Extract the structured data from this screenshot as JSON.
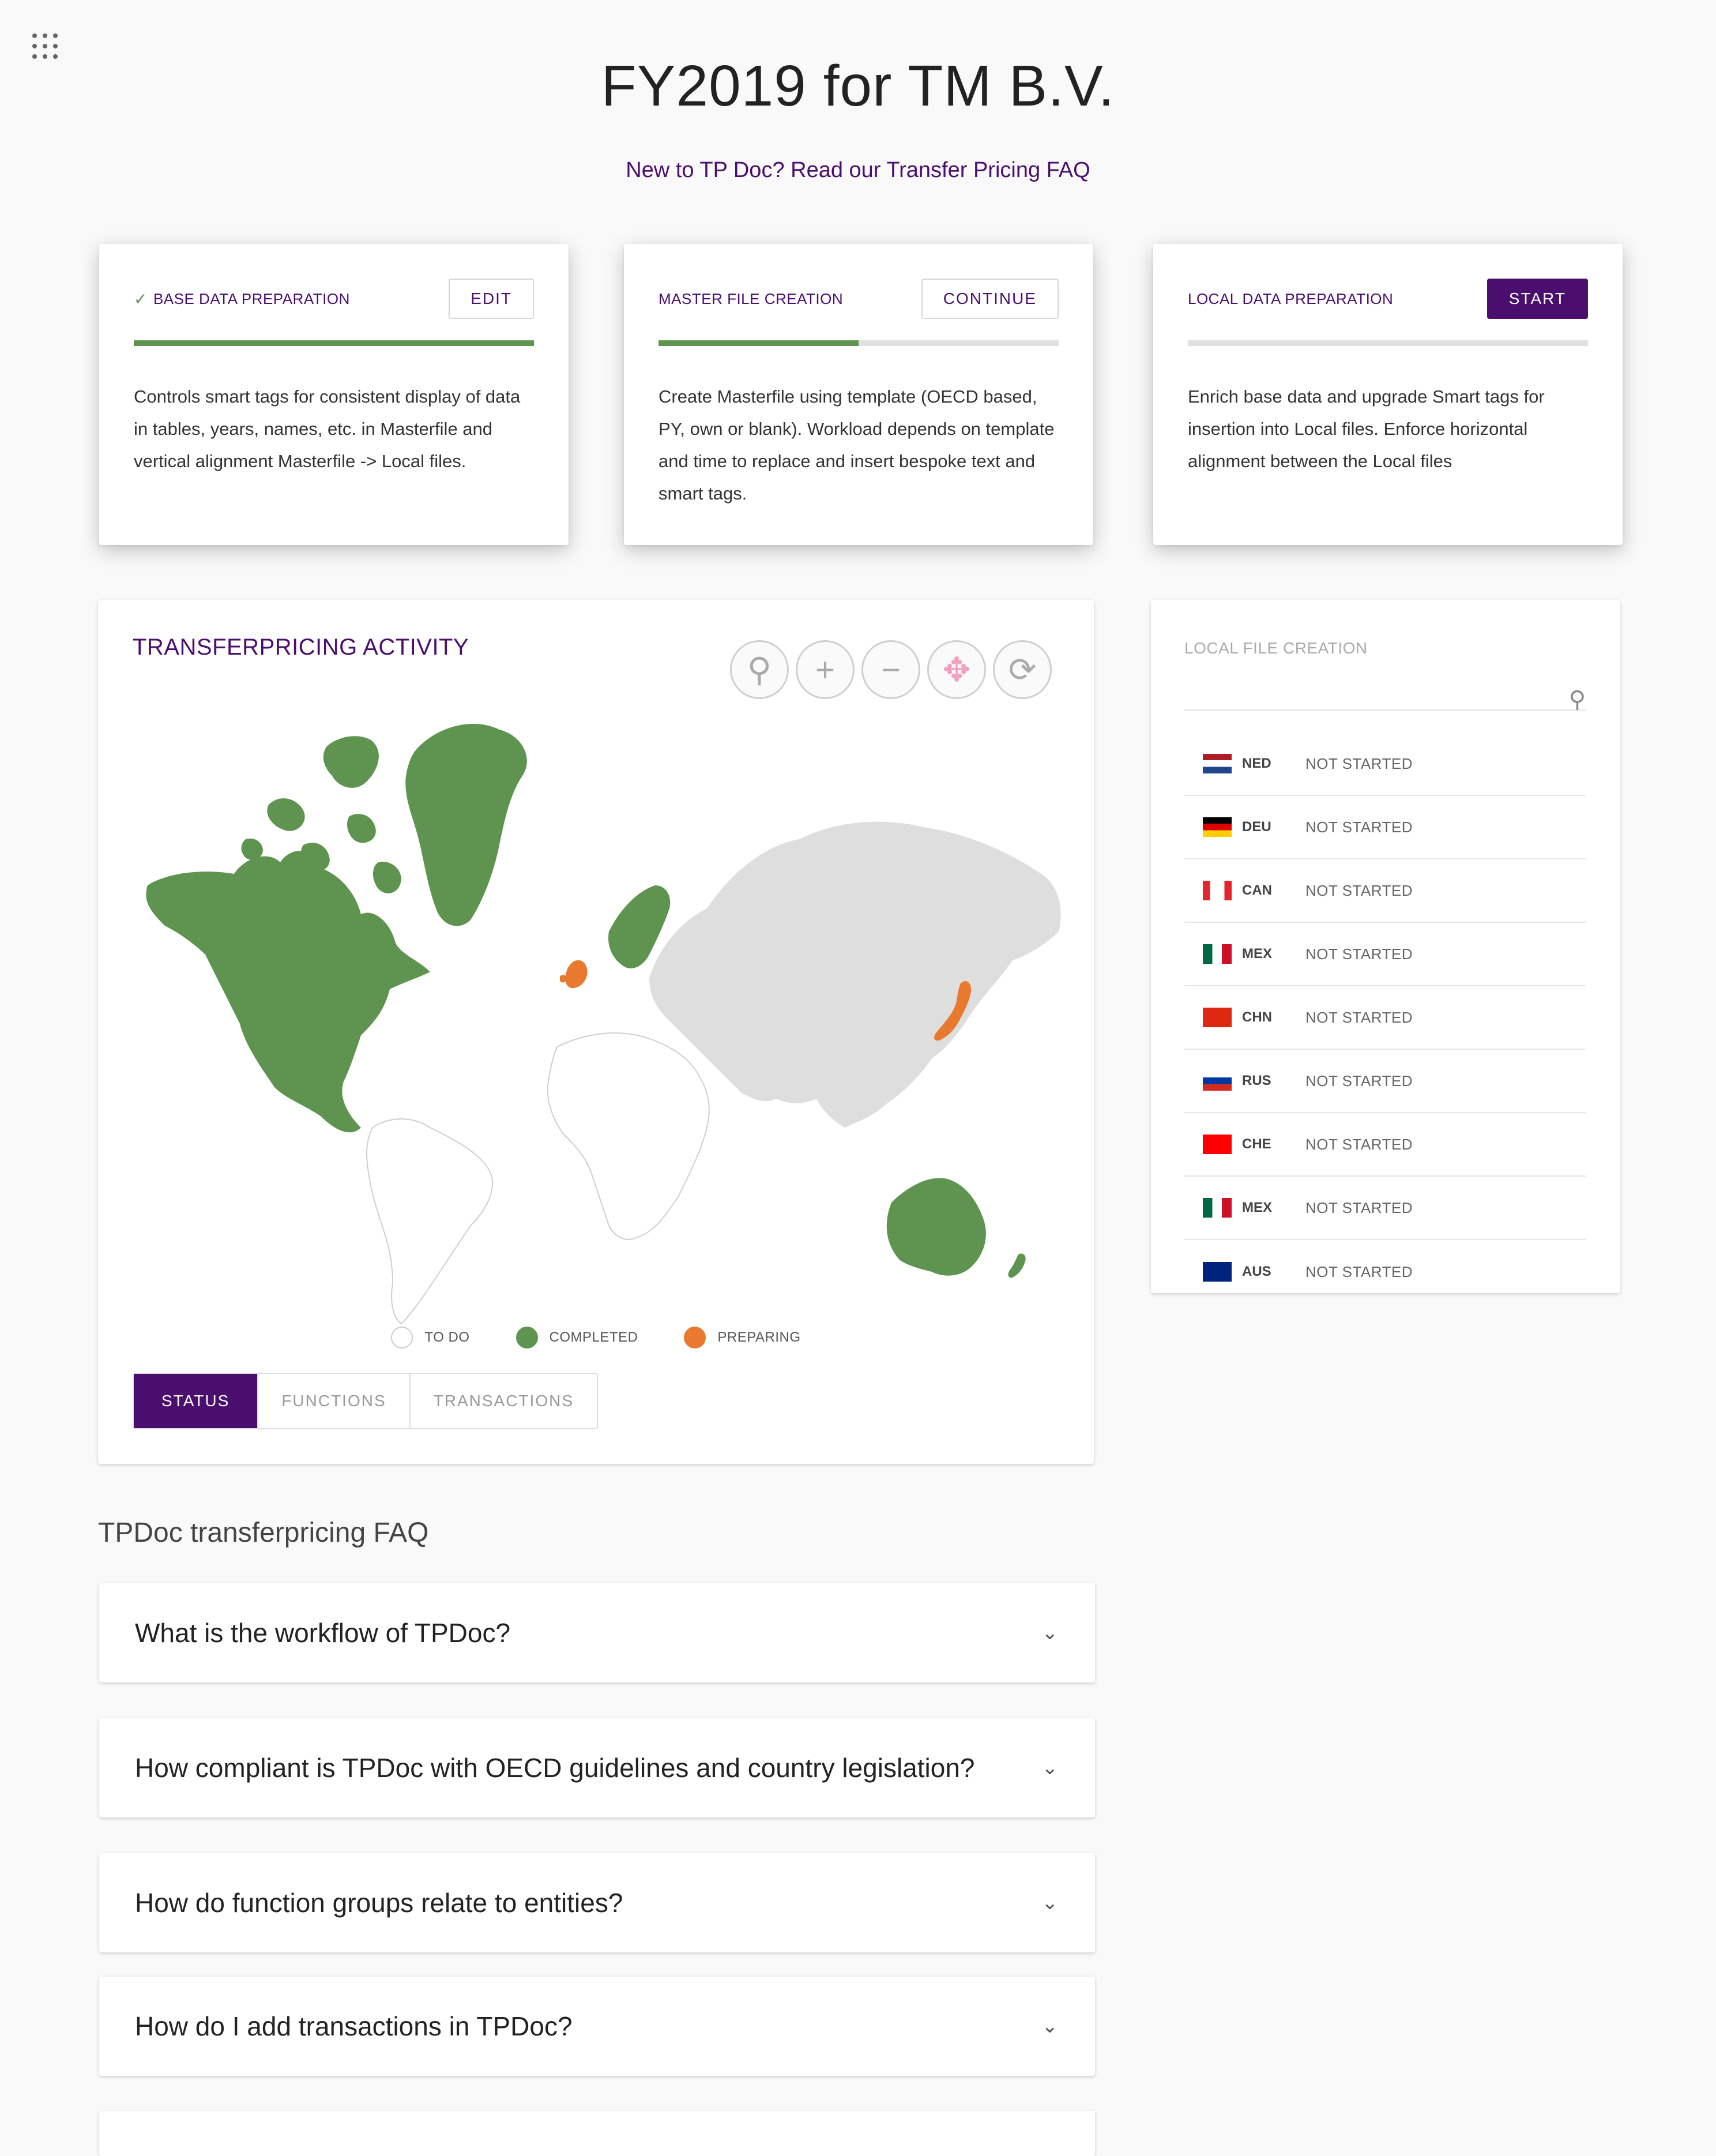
{
  "header": {
    "title": "FY2019 for TM B.V.",
    "faq_link": "New to TP Doc? Read our Transfer Pricing FAQ"
  },
  "steps": [
    {
      "title": "BASE DATA PREPARATION",
      "completed": true,
      "button": "EDIT",
      "progress_pct": 100,
      "description": "Controls smart tags for consistent display of data in tables, years, names, etc. in Masterfile and vertical alignment Masterfile -> Local files."
    },
    {
      "title": "MASTER FILE CREATION",
      "completed": false,
      "button": "CONTINUE",
      "progress_pct": 50,
      "description": "Create Masterfile using template (OECD based, PY, own or blank). Workload depends on template and time to replace and insert bespoke text and smart tags."
    },
    {
      "title": "LOCAL DATA PREPARATION",
      "completed": false,
      "button": "START",
      "progress_pct": 0,
      "description": "Enrich base data and upgrade Smart tags for insertion into Local files. Enforce horizontal alignment between the Local files"
    }
  ],
  "map": {
    "title": "TRANSFERPRICING ACTIVITY",
    "tools": [
      "zoom-icon",
      "plus-icon",
      "minus-icon",
      "move-icon",
      "reset-icon"
    ],
    "legend": [
      {
        "label": "TO DO",
        "color": "#ffffff"
      },
      {
        "label": "COMPLETED",
        "color": "#5e9450"
      },
      {
        "label": "PREPARING",
        "color": "#e8792f"
      }
    ],
    "tabs": [
      "STATUS",
      "FUNCTIONS",
      "TRANSACTIONS"
    ],
    "colors": {
      "todo": "#ffffff",
      "completed": "#5e9450",
      "preparing": "#e8792f",
      "other": "#dedede"
    }
  },
  "local_files": {
    "title": "LOCAL FILE CREATION",
    "rows": [
      {
        "code": "NED",
        "status": "NOT STARTED",
        "flag": "ned"
      },
      {
        "code": "DEU",
        "status": "NOT STARTED",
        "flag": "deu"
      },
      {
        "code": "CAN",
        "status": "NOT STARTED",
        "flag": "can"
      },
      {
        "code": "MEX",
        "status": "NOT STARTED",
        "flag": "mex"
      },
      {
        "code": "CHN",
        "status": "NOT STARTED",
        "flag": "chn"
      },
      {
        "code": "RUS",
        "status": "NOT STARTED",
        "flag": "rus"
      },
      {
        "code": "CHE",
        "status": "NOT STARTED",
        "flag": "che"
      },
      {
        "code": "MEX",
        "status": "NOT STARTED",
        "flag": "mex"
      },
      {
        "code": "AUS",
        "status": "NOT STARTED",
        "flag": "aus"
      }
    ]
  },
  "faq": {
    "title": "TPDoc transferpricing FAQ",
    "questions": [
      "What is the workflow of TPDoc?",
      "How compliant is TPDoc with OECD guidelines and country legislation?",
      "How do function groups relate to entities?",
      "How do I add transactions in TPDoc?"
    ]
  }
}
